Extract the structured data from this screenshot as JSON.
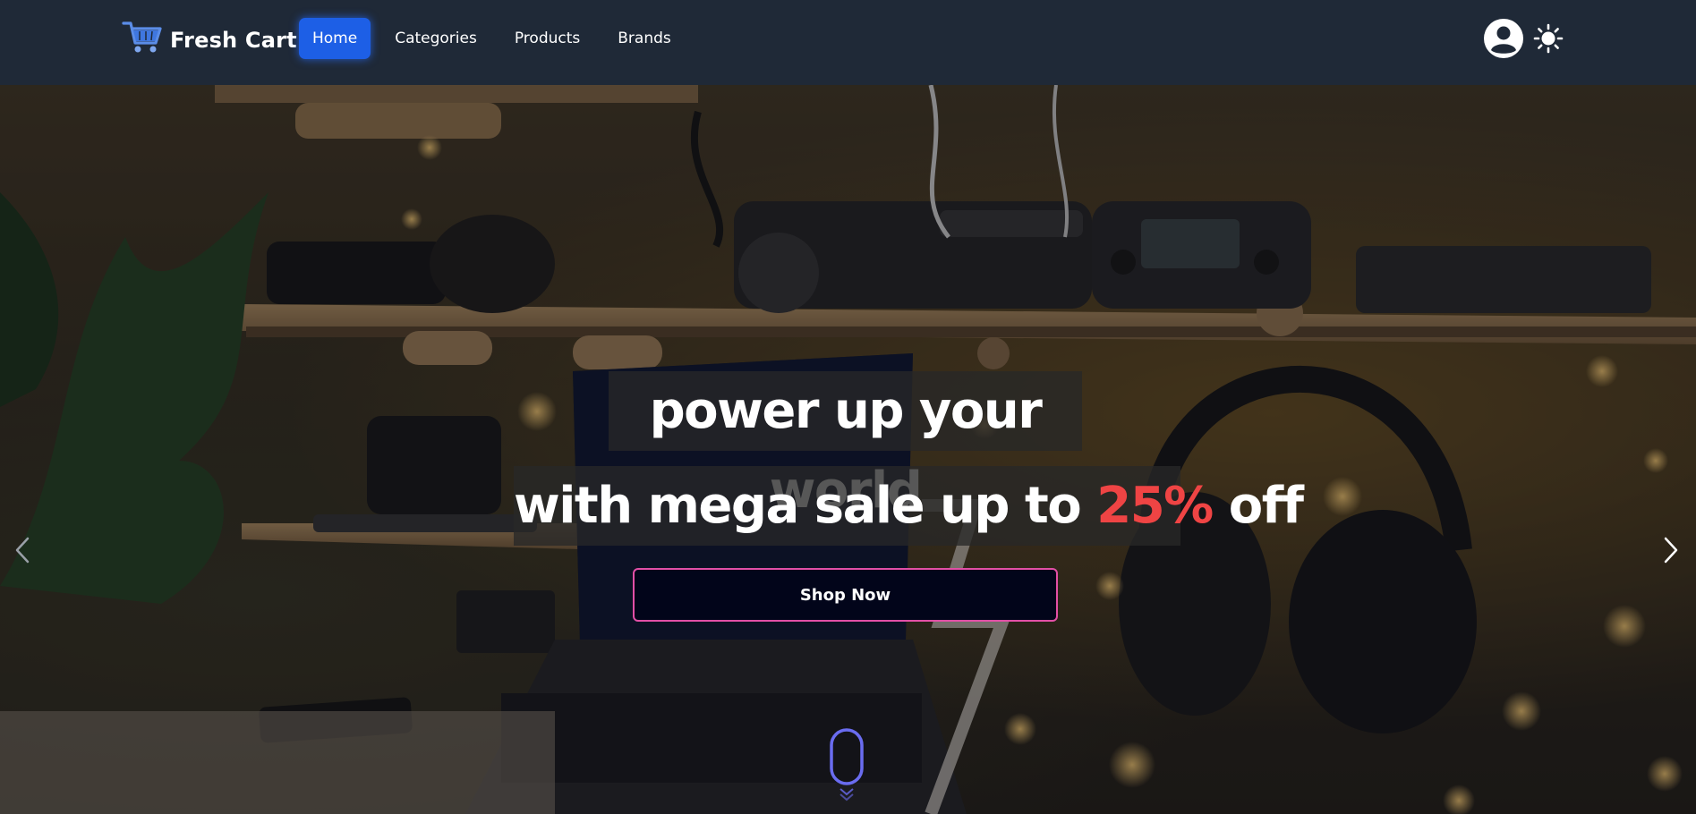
{
  "brand": {
    "name": "Fresh Cart",
    "logo_icon": "cart-icon"
  },
  "nav": {
    "items": [
      {
        "label": "Home",
        "active": true
      },
      {
        "label": "Categories",
        "active": false
      },
      {
        "label": "Products",
        "active": false
      },
      {
        "label": "Brands",
        "active": false
      }
    ],
    "account_icon": "user-circle-icon",
    "theme_icon": "sun-icon"
  },
  "hero": {
    "headline_line1": "power up your world",
    "headline_line2_prefix": "with mega sale up to ",
    "headline_line2_highlight": "25%",
    "headline_line2_suffix": " off",
    "cta_label": "Shop Now",
    "prev_icon": "chevron-left-icon",
    "next_icon": "chevron-right-icon",
    "scroll_icon": "mouse-scroll-icon"
  },
  "colors": {
    "navbar_bg": "#1f2937",
    "active_nav": "#1d5fe6",
    "highlight": "#ef4444",
    "cta_border": "#e24fa6",
    "cta_bg": "#02051a",
    "scroll_indicator": "#6a6cf0"
  }
}
